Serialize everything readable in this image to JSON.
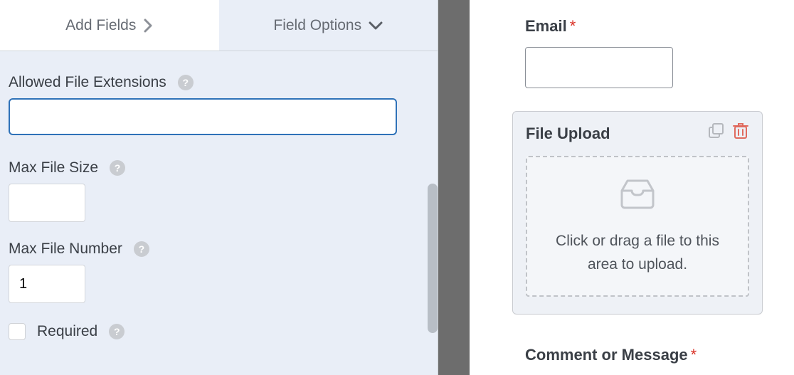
{
  "tabs": {
    "add_fields": "Add Fields",
    "field_options": "Field Options"
  },
  "options": {
    "allowed_ext_label": "Allowed File Extensions",
    "allowed_ext_value": "",
    "max_size_label": "Max File Size",
    "max_size_value": "",
    "max_number_label": "Max File Number",
    "max_number_value": "1",
    "required_label": "Required"
  },
  "preview": {
    "email_label": "Email",
    "upload_title": "File Upload",
    "drop_text": "Click or drag a file to this area to upload.",
    "comment_label": "Comment or Message"
  },
  "glyphs": {
    "required_mark": "*",
    "help": "?"
  }
}
